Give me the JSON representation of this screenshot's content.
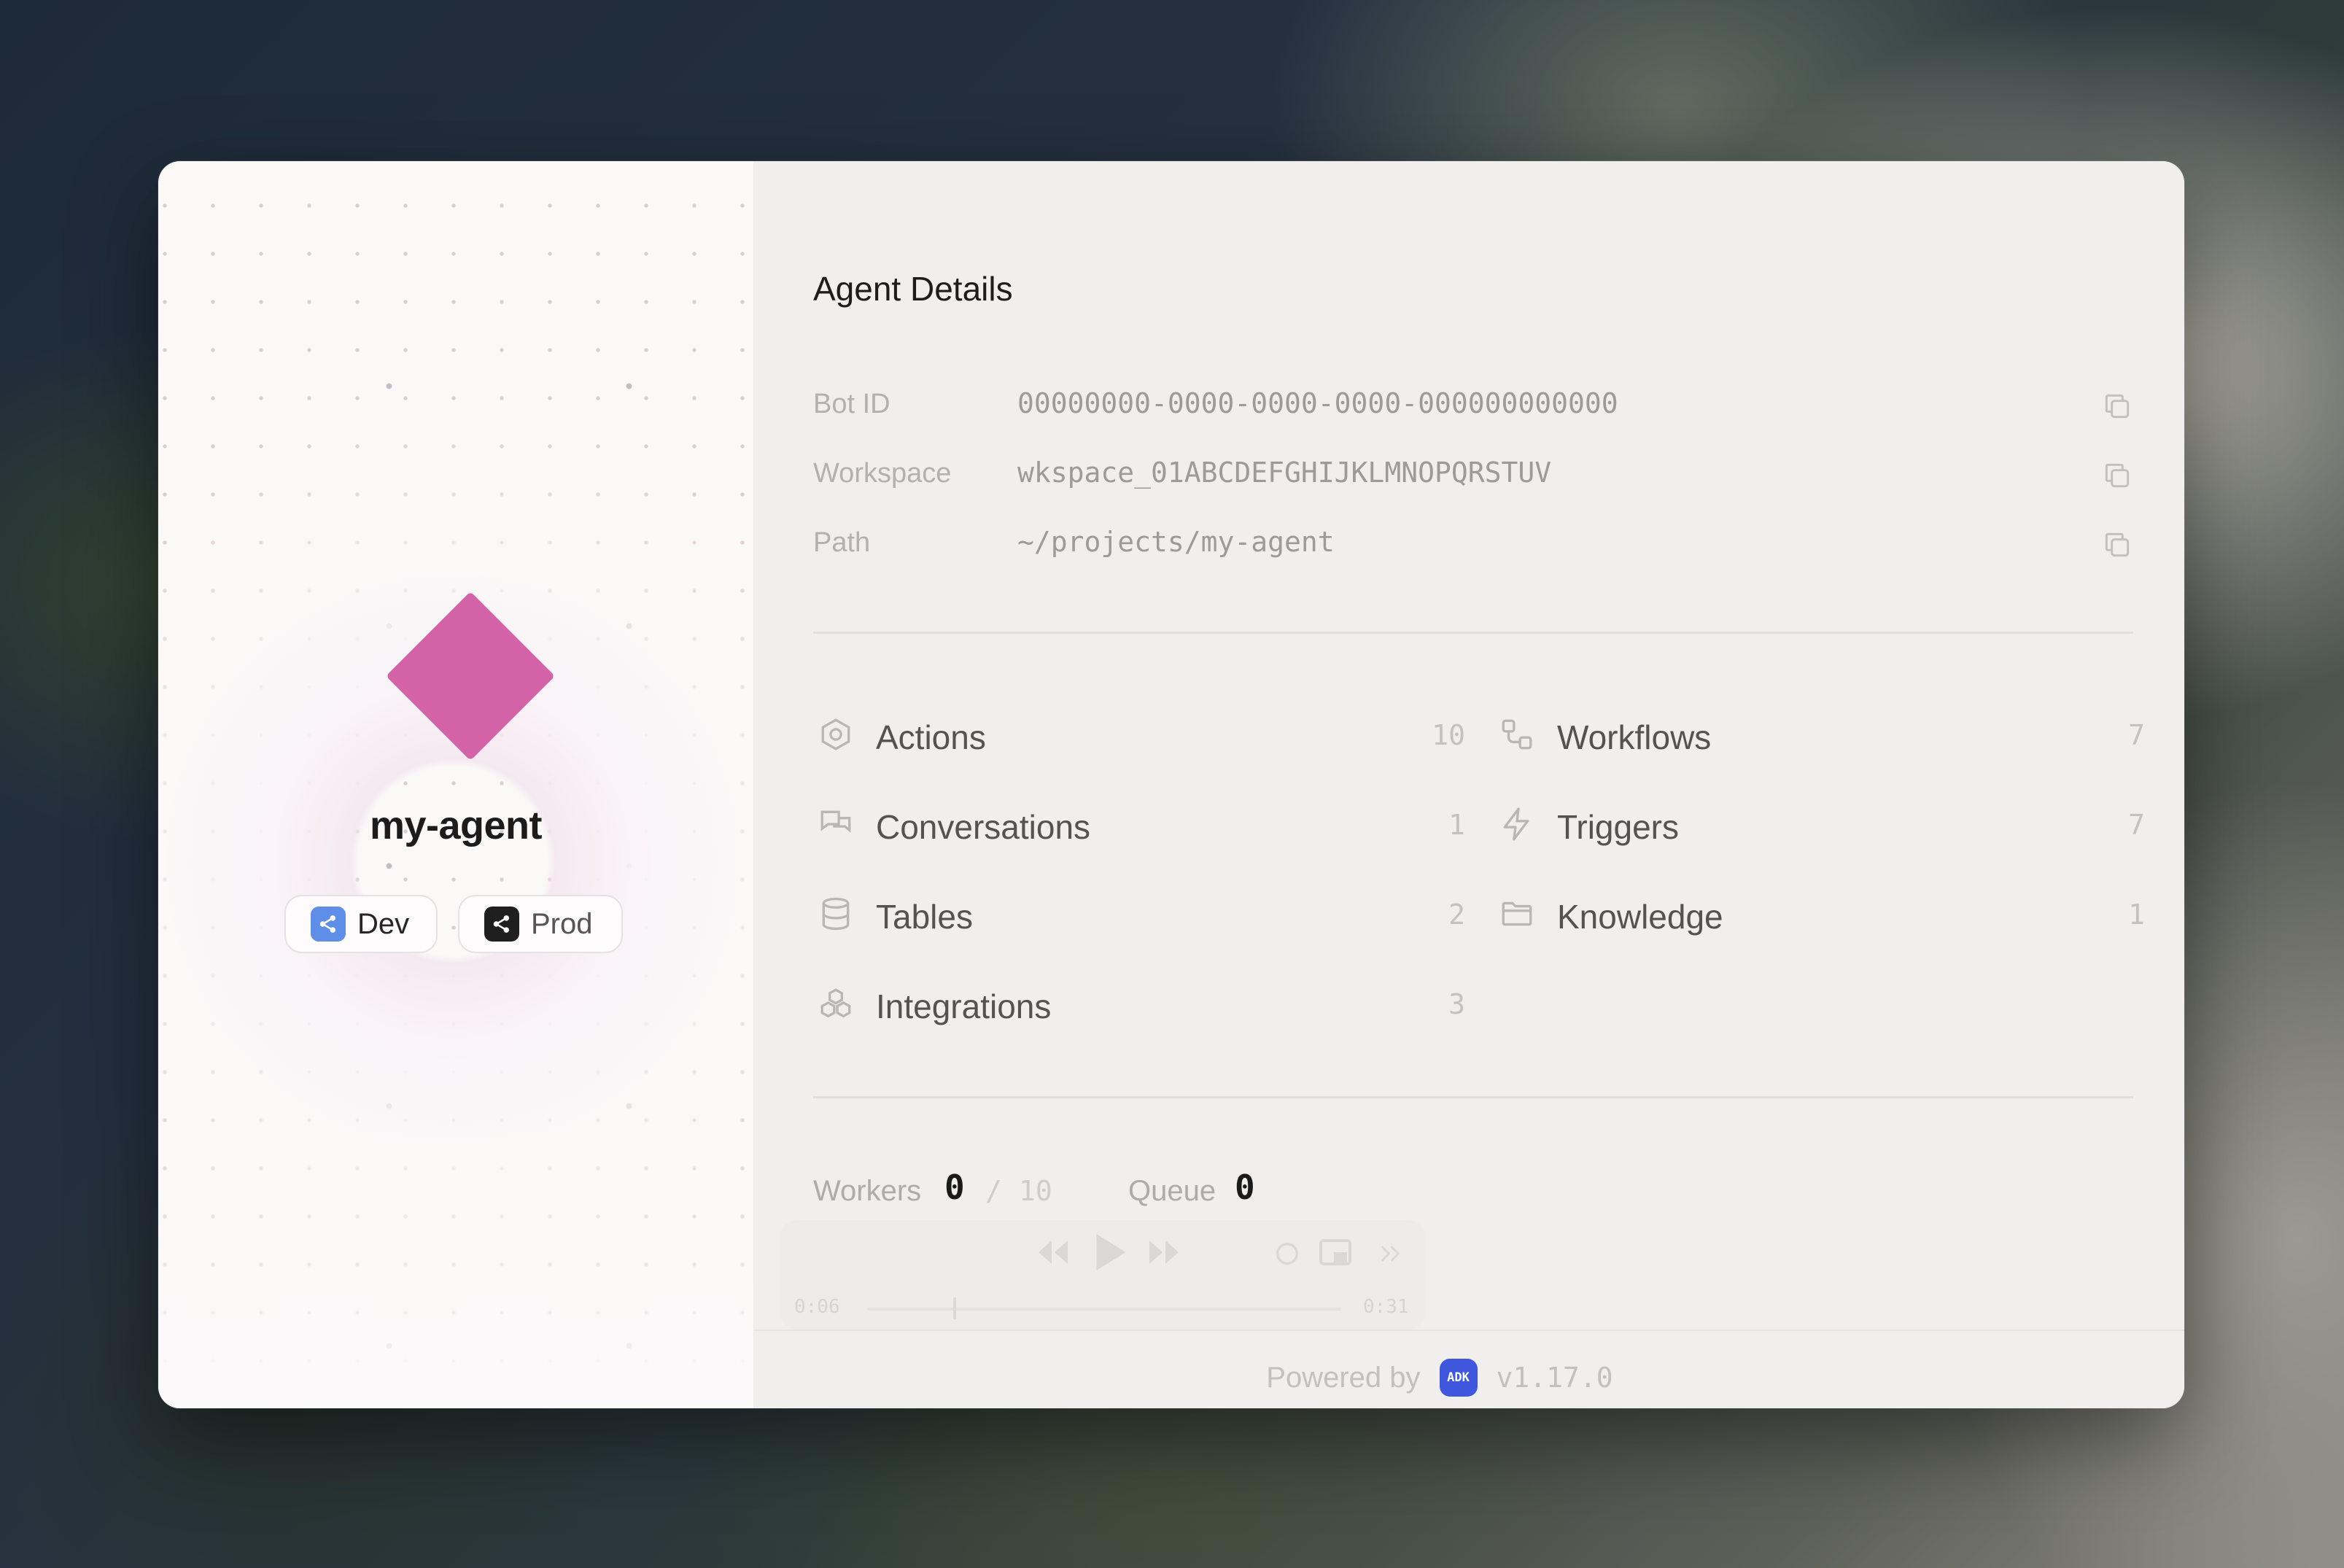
{
  "agent": {
    "name": "my-agent",
    "color": "#d362a7",
    "environments": [
      {
        "label": "Dev",
        "badge_color": "#5f8ee9"
      },
      {
        "label": "Prod",
        "badge_color": "#1f1f1f"
      }
    ]
  },
  "details": {
    "title": "Agent Details",
    "rows": [
      {
        "label": "Bot ID",
        "value": "00000000-0000-0000-0000-000000000000"
      },
      {
        "label": "Workspace",
        "value": "wkspace_01ABCDEFGHIJKLMNOPQRSTUV"
      },
      {
        "label": "Path",
        "value": "~/projects/my-agent"
      }
    ]
  },
  "stats": {
    "left": [
      {
        "name": "Actions",
        "count": "10",
        "icon": "hexagon-icon"
      },
      {
        "name": "Conversations",
        "count": "1",
        "icon": "chat-bubbles-icon"
      },
      {
        "name": "Tables",
        "count": "2",
        "icon": "database-icon"
      },
      {
        "name": "Integrations",
        "count": "3",
        "icon": "boxes-icon"
      }
    ],
    "right": [
      {
        "name": "Workflows",
        "count": "7",
        "icon": "workflow-icon"
      },
      {
        "name": "Triggers",
        "count": "7",
        "icon": "lightning-icon"
      },
      {
        "name": "Knowledge",
        "count": "1",
        "icon": "folder-icon"
      }
    ]
  },
  "metrics": {
    "workers_label": "Workers",
    "workers_value": "0",
    "workers_separator": "/",
    "workers_max": "10",
    "queue_label": "Queue",
    "queue_value": "0"
  },
  "player": {
    "time_start": "0:06",
    "time_end": "0:31"
  },
  "footer": {
    "powered_by": "Powered by",
    "badge_text": "ADK",
    "version": "v1.17.0",
    "badge_color": "#3e57dc"
  }
}
